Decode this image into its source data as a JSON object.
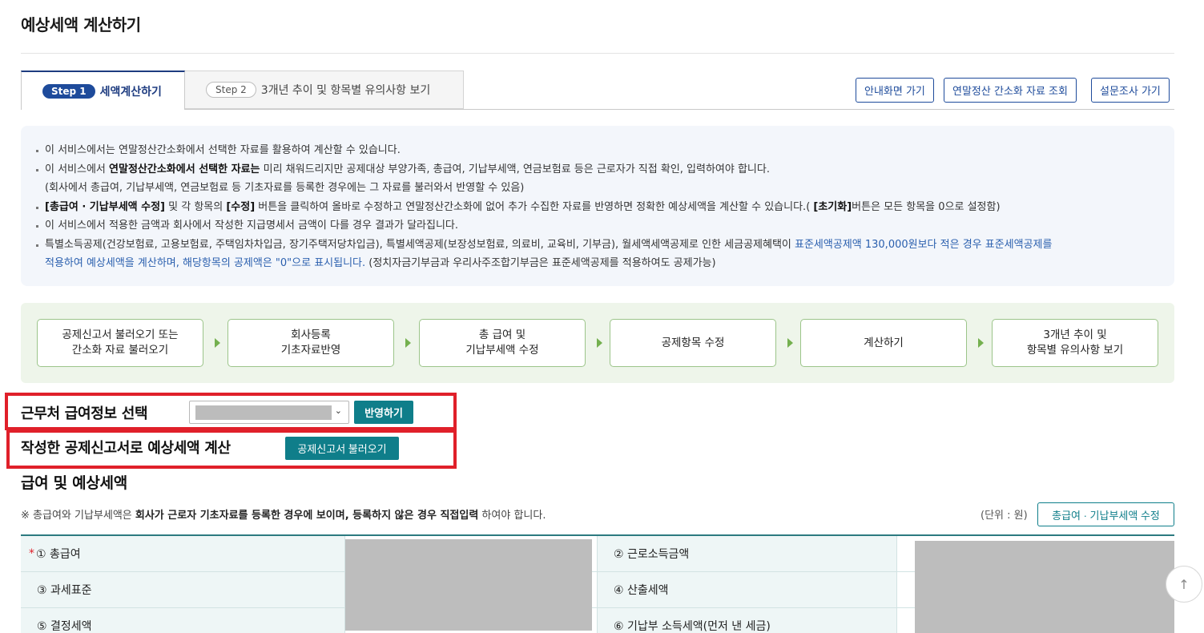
{
  "page": {
    "title": "예상세액 계산하기"
  },
  "tabs": [
    {
      "step": "Step 1",
      "label": "세액계산하기"
    },
    {
      "step": "Step 2",
      "label": "3개년 추이 및 항목별 유의사항 보기"
    }
  ],
  "top_buttons": {
    "guide": "안내화면 가기",
    "simplified": "연말정산 간소화 자료 조회",
    "survey": "설문조사 가기"
  },
  "notice": {
    "items": [
      {
        "text": "이 서비스에서는 연말정산간소화에서 선택한 자료를 활용하여 계산할 수 있습니다."
      },
      {
        "pre": "이 서비스에서 ",
        "bold": "연말정산간소화에서 선택한 자료는",
        "post": " 미리 채워드리지만 공제대상 부양가족, 총급여, 기납부세액, 연금보험료 등은 근로자가 직접 확인, 입력하여야 합니다.",
        "sub": "(회사에서 총급여, 기납부세액, 연금보험료 등 기초자료를 등록한 경우에는 그 자료를 불러와서 반영할 수 있음)"
      },
      {
        "b1": "[총급여 · 기납부세액 수정]",
        "m1": " 및 각 항목의 ",
        "b2": "[수정]",
        "m2": " 버튼을 클릭하여 올바로 수정하고 연말정산간소화에 없어 추가 수집한 자료를 반영하면 정확한 예상세액을 계산할 수 있습니다.( ",
        "b3": "[초기화]",
        "m3": "버튼은 모든 항목을 0으로 설정함)"
      },
      {
        "text": "이 서비스에서 적용한 금액과 회사에서 작성한 지급명세서 금액이 다를 경우 결과가 달라집니다."
      },
      {
        "pre": "특별소득공제(건강보험료, 고용보험료, 주택임차차입금, 장기주택저당차입금), 특별세액공제(보장성보험료, 의료비, 교육비, 기부금), 월세액세액공제로 인한 세금공제혜택이 ",
        "blue1": "표준세액공제액 130,000원보다 적은 경우 표준세액공제를",
        "blue2": "적용하여 예상세액을 계산하며, 해당항목의 공제액은 \"0\"으로 표시됩니다.",
        "post": " (정치자금기부금과 우리사주조합기부금은 표준세액공제를 적용하여도 공제가능)"
      }
    ]
  },
  "flow_steps": [
    "공제신고서 불러오기 또는\n간소화 자료 불러오기",
    "회사등록\n기초자료반영",
    "총 급여 및\n기납부세액 수정",
    "공제항목 수정",
    "계산하기",
    "3개년 추이 및\n항목별 유의사항 보기"
  ],
  "workplace": {
    "label": "근무처 급여정보 선택",
    "apply_button": "반영하기"
  },
  "deduction_form": {
    "label": "작성한 공제신고서로 예상세액 계산",
    "load_button": "공제신고서 불러오기"
  },
  "salary_section": {
    "title": "급여 및 예상세액",
    "note": {
      "pre": "※ 총급여와 기납부세액은 ",
      "bold1": "회사가 근로자 기초자료를 등록한 경우에 보이며, 등록하지 않은 경우 직접입력",
      "post": " 하여야 합니다."
    },
    "unit": "(단위 : 원)",
    "edit_button": "총급여 · 기납부세액 수정",
    "rows": [
      {
        "left": "① 총급여",
        "required": "*",
        "right": "② 근로소득금액"
      },
      {
        "left": "③ 과세표준",
        "right": "④ 산출세액"
      },
      {
        "left": "⑤ 결정세액",
        "right": "⑥ 기납부 소득세액(먼저 낸 세금)"
      }
    ]
  },
  "icons": {
    "scroll_top": "arrow-up-icon",
    "select": "chevron-down-icon"
  },
  "colors": {
    "accent": "#1e4b9b",
    "teal": "#0f7e8a",
    "highlight": "#e0202a"
  }
}
